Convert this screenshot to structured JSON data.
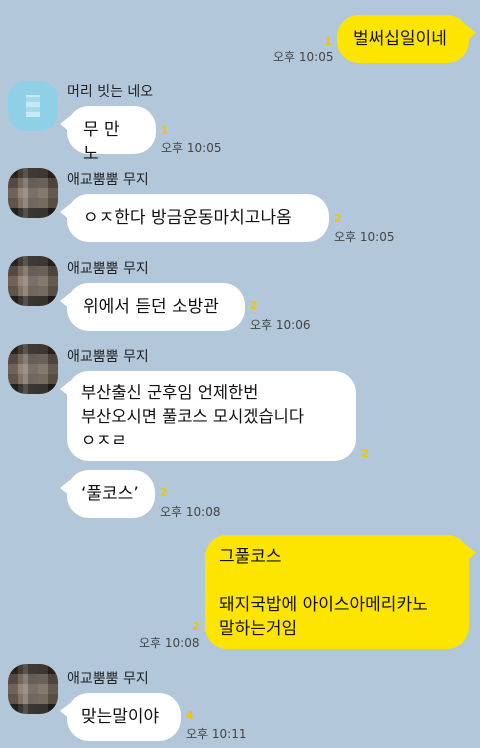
{
  "messages": [
    {
      "id": "m1",
      "side": "out",
      "text": "벌써십일이네",
      "unread": "1",
      "time": "오후 10:05"
    },
    {
      "id": "m2",
      "side": "in",
      "sender": "머리 빗는 네오",
      "text": "무 만 노",
      "unread": "1",
      "time": "오후 10:05"
    },
    {
      "id": "m3",
      "side": "in",
      "sender": "애교뿜뿜 무지",
      "text": "ㅇㅈ한다 방금운동마치고나옴",
      "unread": "2",
      "time": "오후 10:05"
    },
    {
      "id": "m4",
      "side": "in",
      "sender": "애교뿜뿜 무지",
      "text": "위에서 듣던 소방관",
      "unread": "2",
      "time": "오후 10:06"
    },
    {
      "id": "m5",
      "side": "in",
      "sender": "애교뿜뿜 무지",
      "text": "부산출신 군후임 언제한번\n부산오시면 풀코스 모시겠습니다\nㅇㅈㄹ",
      "unread": "2"
    },
    {
      "id": "m6",
      "side": "in",
      "text": "‘풀코스’",
      "unread": "2",
      "time": "오후 10:08"
    },
    {
      "id": "m7",
      "side": "out",
      "text": "그풀코스\n\n돼지국밥에 아이스아메리카노\n말하는거임",
      "unread": "2",
      "time": "오후 10:08"
    },
    {
      "id": "m8",
      "side": "in",
      "sender": "애교뿜뿜 무지",
      "text": "맞는말이야",
      "unread": "4",
      "time": "오후 10:11"
    }
  ],
  "colors": {
    "background": "#b2c7d9",
    "incoming": "#ffffff",
    "outgoing": "#fee500",
    "unread": "#f2c400"
  }
}
